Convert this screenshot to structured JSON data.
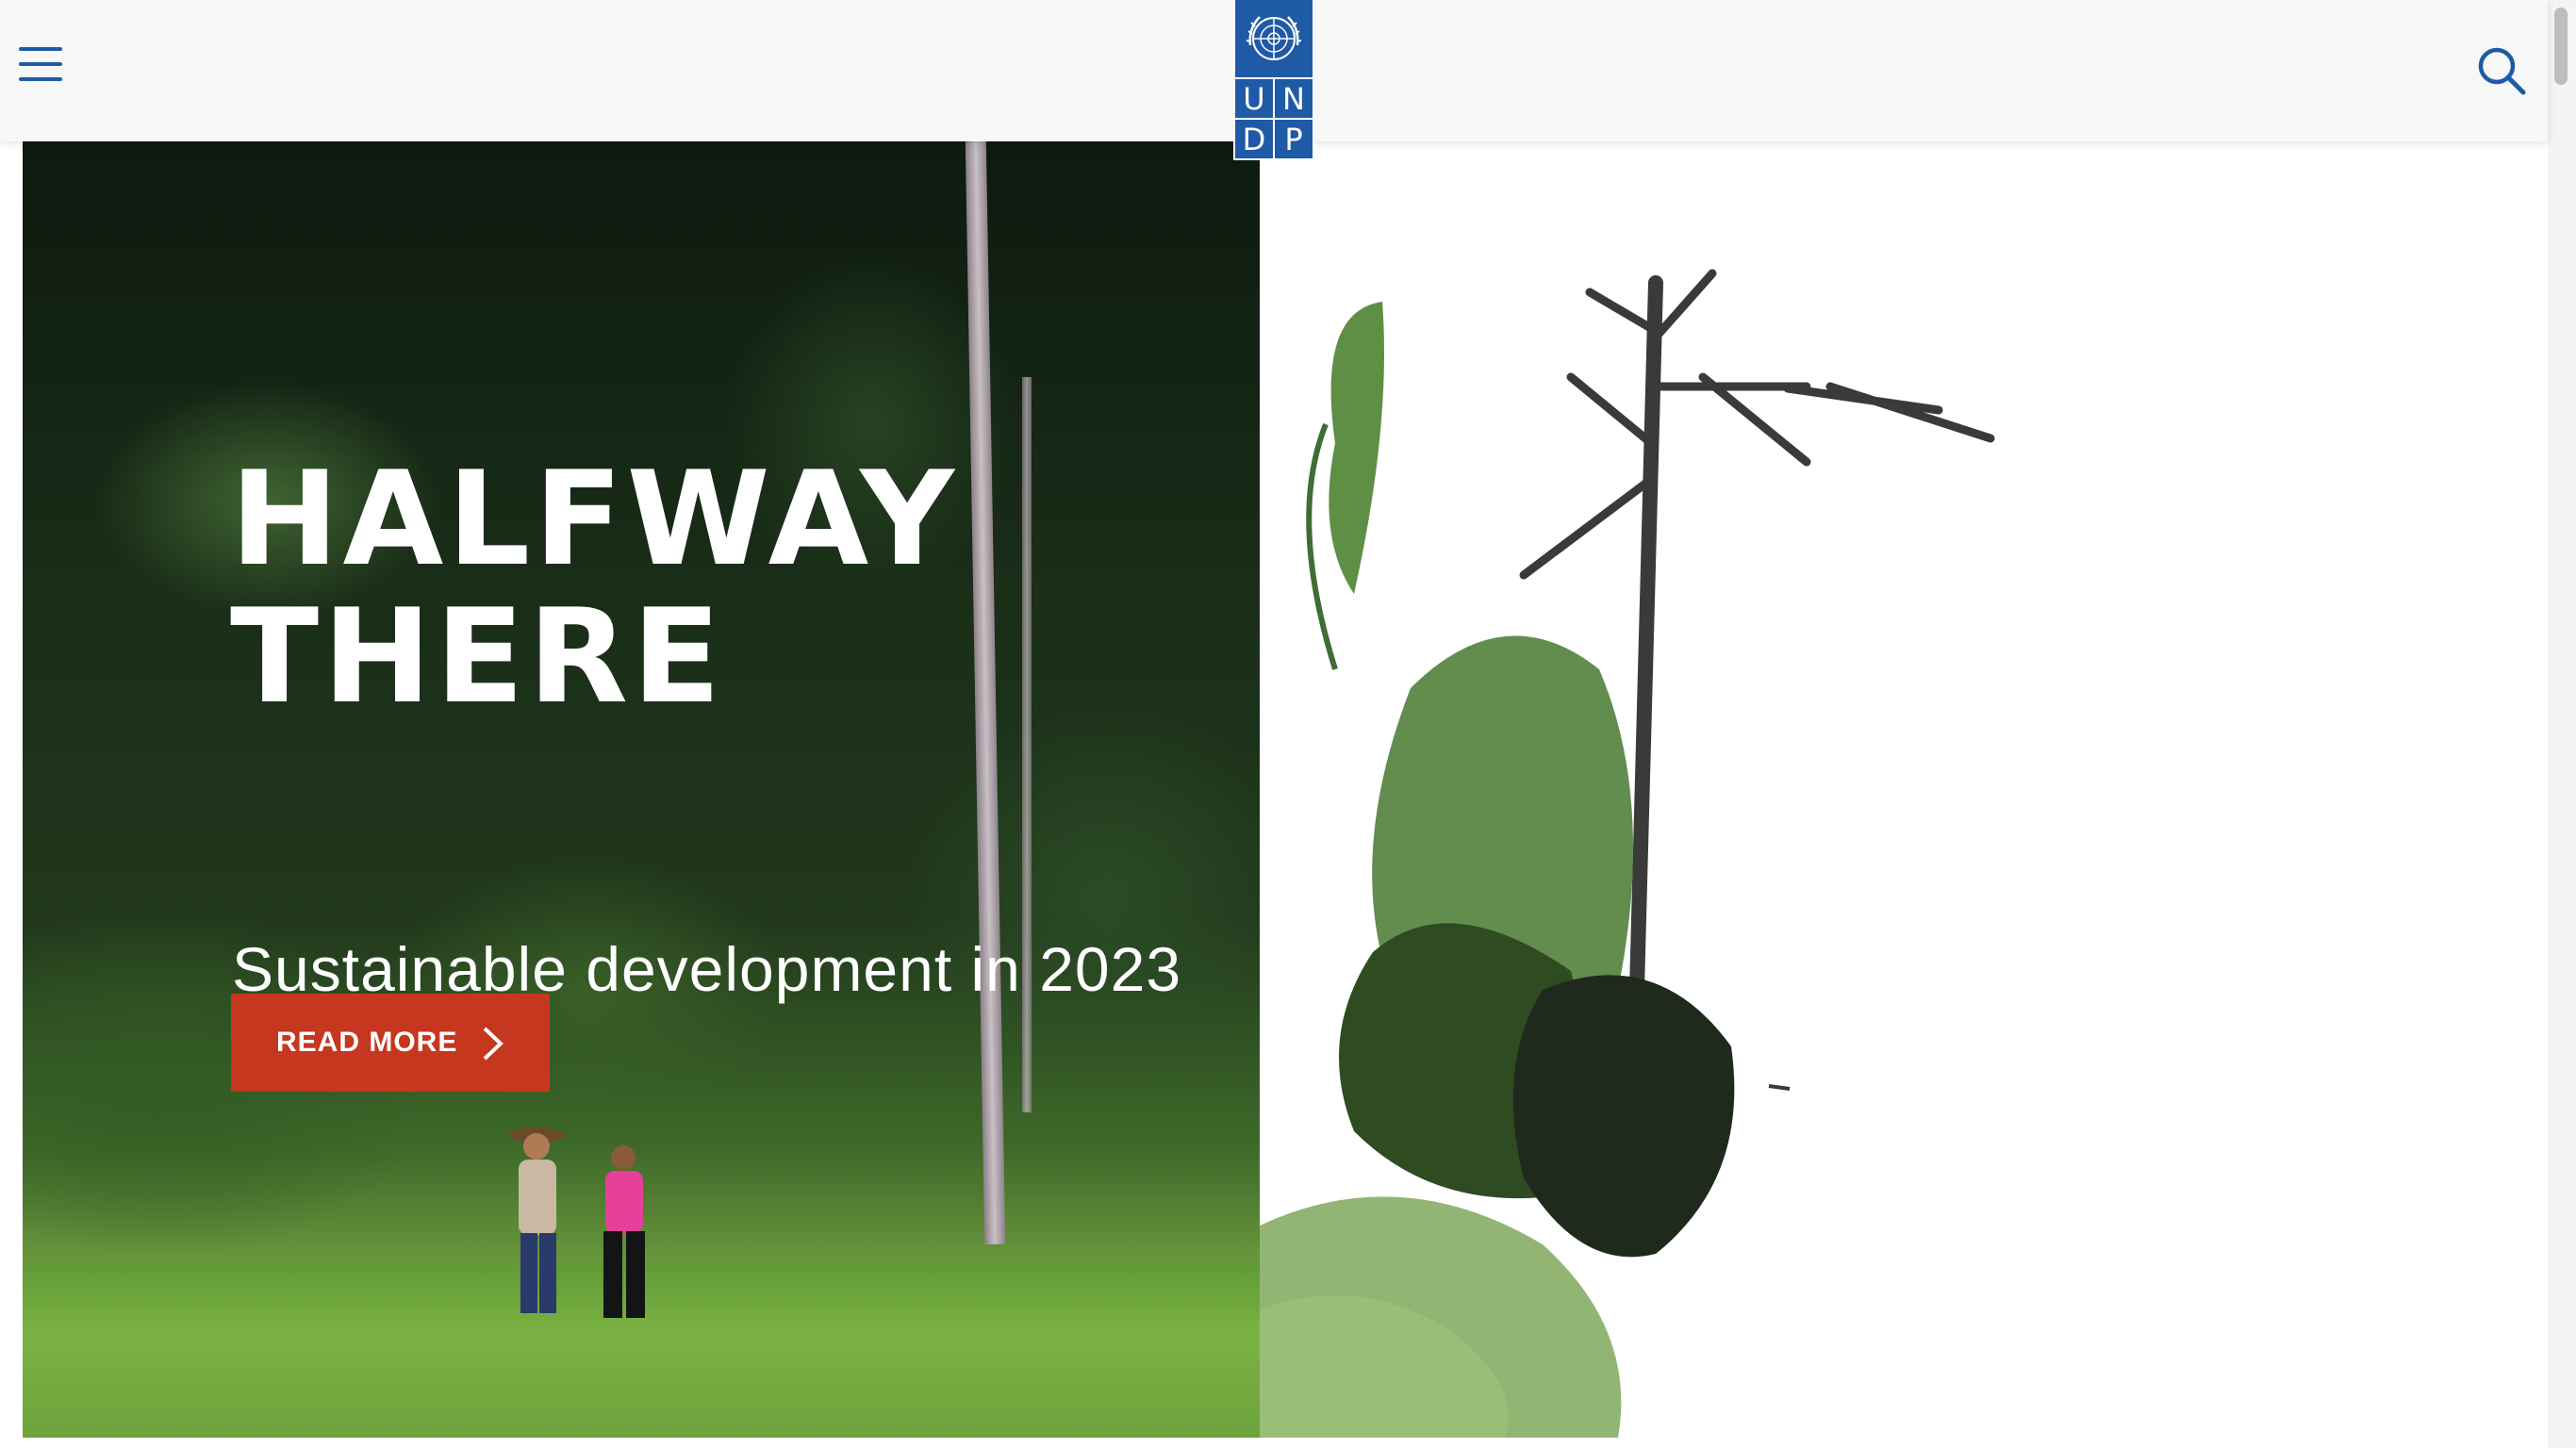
{
  "header": {
    "menu_icon": "hamburger-menu-icon",
    "search_icon": "search-icon",
    "logo": {
      "emblem": "un-emblem-icon",
      "letters": [
        "U",
        "N",
        "D",
        "P"
      ]
    }
  },
  "hero": {
    "title_line1": "HALFWAY",
    "title_line2": "THERE",
    "subtitle": "Sustainable development in 2023",
    "cta_label": "READ MORE",
    "cta_icon": "chevron-right-icon"
  },
  "colors": {
    "brand_blue": "#1f5aa6",
    "cta_red": "#c6371f",
    "header_bg": "#f7f7f7"
  }
}
